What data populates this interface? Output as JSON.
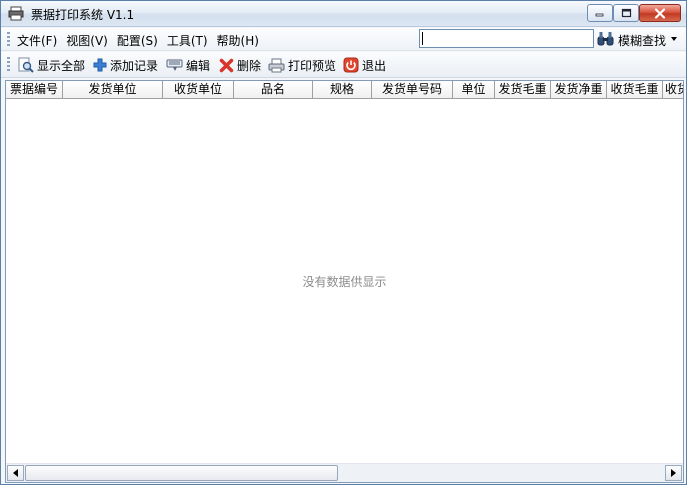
{
  "window": {
    "title": "票据打印系统 V1.1"
  },
  "menu": {
    "items": [
      {
        "label": "文件(F)"
      },
      {
        "label": "视图(V)"
      },
      {
        "label": "配置(S)"
      },
      {
        "label": "工具(T)"
      },
      {
        "label": "帮助(H)"
      }
    ]
  },
  "search": {
    "value": "",
    "button_label": "模糊查找"
  },
  "toolbar": {
    "show_all": "显示全部",
    "add_record": "添加记录",
    "edit": "编辑",
    "delete": "删除",
    "print_preview": "打印预览",
    "exit": "退出"
  },
  "table": {
    "columns": [
      "票据编号",
      "发货单位",
      "收货单位",
      "品名",
      "规格",
      "发货单号码",
      "单位",
      "发货毛重",
      "发货净重",
      "收货毛重",
      "收货"
    ],
    "empty_message": "没有数据供显示"
  },
  "colors": {
    "close_button": "#c23a22",
    "add_icon": "#3b7ed6",
    "delete_icon": "#d8362a",
    "exit_icon": "#e0452f"
  }
}
